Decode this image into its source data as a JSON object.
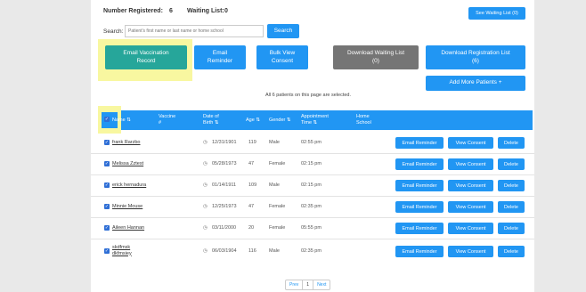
{
  "summary": {
    "registered_label": "Number Registered:",
    "registered_count": "6",
    "waiting_label": "Waiting List:",
    "waiting_count": "0"
  },
  "search": {
    "label": "Search:",
    "placeholder": "Patient's first name or last name or home school",
    "button": "Search"
  },
  "see_waiting_list": "See Waiting List (0)",
  "actions": {
    "email_vaccination_record": "Email Vaccination\nRecord",
    "email_reminder": "Email\nReminder",
    "bulk_view_consent": "Bulk View\nConsent",
    "download_waiting_list": "Download Waiting List\n(0)",
    "download_registration_list": "Download Registration List\n(6)",
    "add_more_patients": "Add More Patients +"
  },
  "selection_message": "All 6 patients on this page are selected.",
  "columns": {
    "name": "Name ⇅",
    "vaccine": "Vaccine\n#",
    "dob": "Date of\nBirth ⇅",
    "age": "Age ⇅",
    "gender": "Gender ⇅",
    "appointment": "Appointment\nTime ⇅",
    "school": "Home\nSchool"
  },
  "row_buttons": {
    "email_reminder": "Email Reminder",
    "view_consent": "View Consent",
    "delete": "Delete"
  },
  "rows": [
    {
      "name": "frank Rarzbo",
      "dob": "12/31/1901",
      "age": "119",
      "gender": "Male",
      "time": "02:55 pm"
    },
    {
      "name": "Melissa Zztest",
      "dob": "05/28/1973",
      "age": "47",
      "gender": "Female",
      "time": "02:15 pm"
    },
    {
      "name": "erick hernadura",
      "dob": "01/14/1911",
      "age": "109",
      "gender": "Male",
      "time": "02:15 pm"
    },
    {
      "name": "Minnie Mouse",
      "dob": "12/25/1973",
      "age": "47",
      "gender": "Female",
      "time": "02:35 pm"
    },
    {
      "name": "Aileen Hannan",
      "dob": "03/11/2000",
      "age": "20",
      "gender": "Female",
      "time": "05:55 pm"
    },
    {
      "name": "skdfmsk\ndkfmsiey",
      "dob": "06/03/1904",
      "age": "116",
      "gender": "Male",
      "time": "02:35 pm"
    }
  ],
  "pagination": {
    "prev": "Prev",
    "page": "1",
    "next": "Next"
  },
  "colors": {
    "blue": "#2196f3",
    "teal": "#26a69a",
    "grey": "#757575",
    "highlight": "#f8f7a0"
  },
  "icons": {
    "dob": "clock-icon",
    "select": "checkbox-icon"
  }
}
